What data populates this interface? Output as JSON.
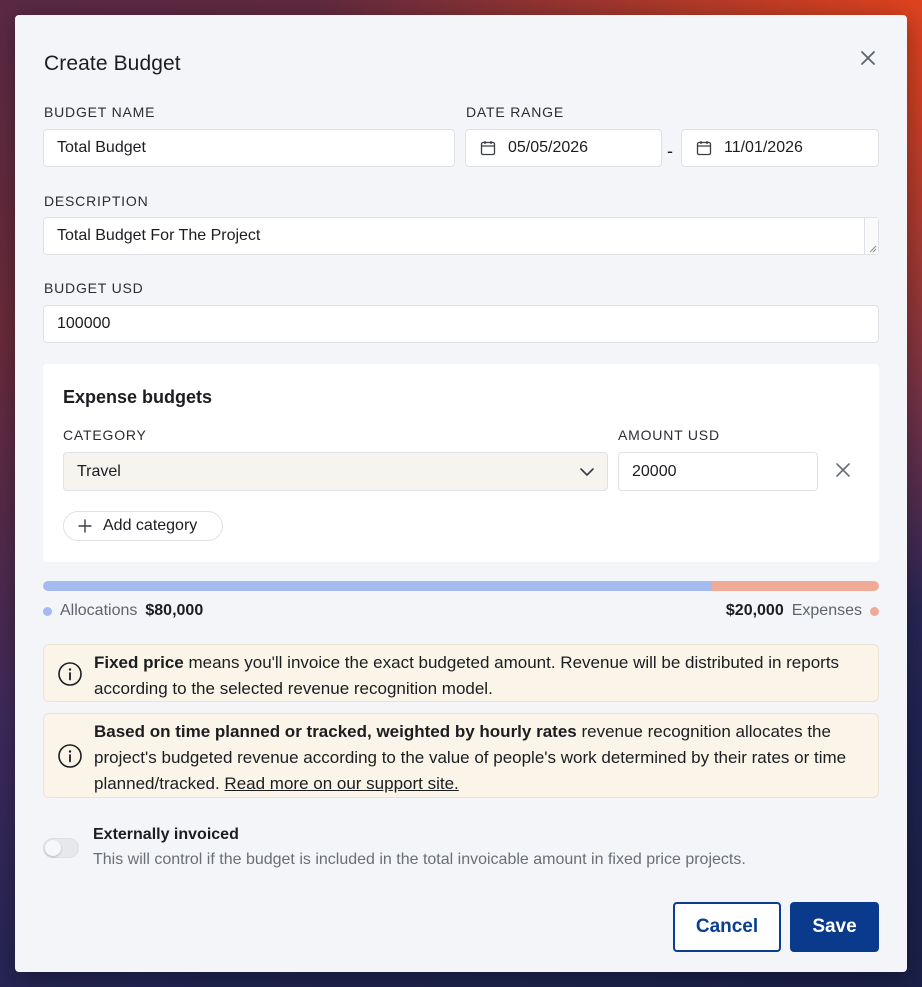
{
  "dialog": {
    "title": "Create Budget"
  },
  "budget_name": {
    "label": "BUDGET NAME",
    "value": "Total Budget"
  },
  "date_range": {
    "label": "DATE RANGE",
    "start": "05/05/2026",
    "separator": "-",
    "end": "11/01/2026"
  },
  "description": {
    "label": "DESCRIPTION",
    "value": "Total Budget For The Project"
  },
  "budget_usd": {
    "label": "BUDGET USD",
    "value": "100000"
  },
  "expense_budgets": {
    "title": "Expense budgets",
    "category_label": "CATEGORY",
    "amount_label": "AMOUNT USD",
    "rows": [
      {
        "category": "Travel",
        "amount": "20000"
      }
    ],
    "add_label": "Add category"
  },
  "allocation": {
    "allocations_label": "Allocations",
    "allocations_value": "$80,000",
    "expenses_label": "Expenses",
    "expenses_value": "$20,000",
    "allocation_fraction": 0.8,
    "colors": {
      "allocations": "#a4bbef",
      "expenses": "#efab97"
    }
  },
  "info_fixed": {
    "bold": "Fixed price",
    "text": " means you'll invoice the exact budgeted amount. Revenue will be distributed in reports according to the selected revenue recognition model."
  },
  "info_time": {
    "bold": "Based on time planned or tracked, weighted by hourly rates",
    "text": " revenue recognition allocates the project's budgeted revenue according to the value of people's work determined by their rates or time planned/tracked. ",
    "link": "Read more on our support site."
  },
  "externally_invoiced": {
    "title": "Externally invoiced",
    "description": "This will control if the budget is included in the total invoicable amount in fixed price projects.",
    "enabled": false
  },
  "actions": {
    "cancel": "Cancel",
    "save": "Save"
  },
  "icons": {
    "close": "close-icon",
    "calendar": "calendar-icon",
    "chevron": "chevron-down-icon",
    "plus": "plus-icon",
    "info": "info-icon"
  },
  "colors": {
    "primary": "#0a3a8c",
    "info_bg": "#fbf4e8"
  }
}
